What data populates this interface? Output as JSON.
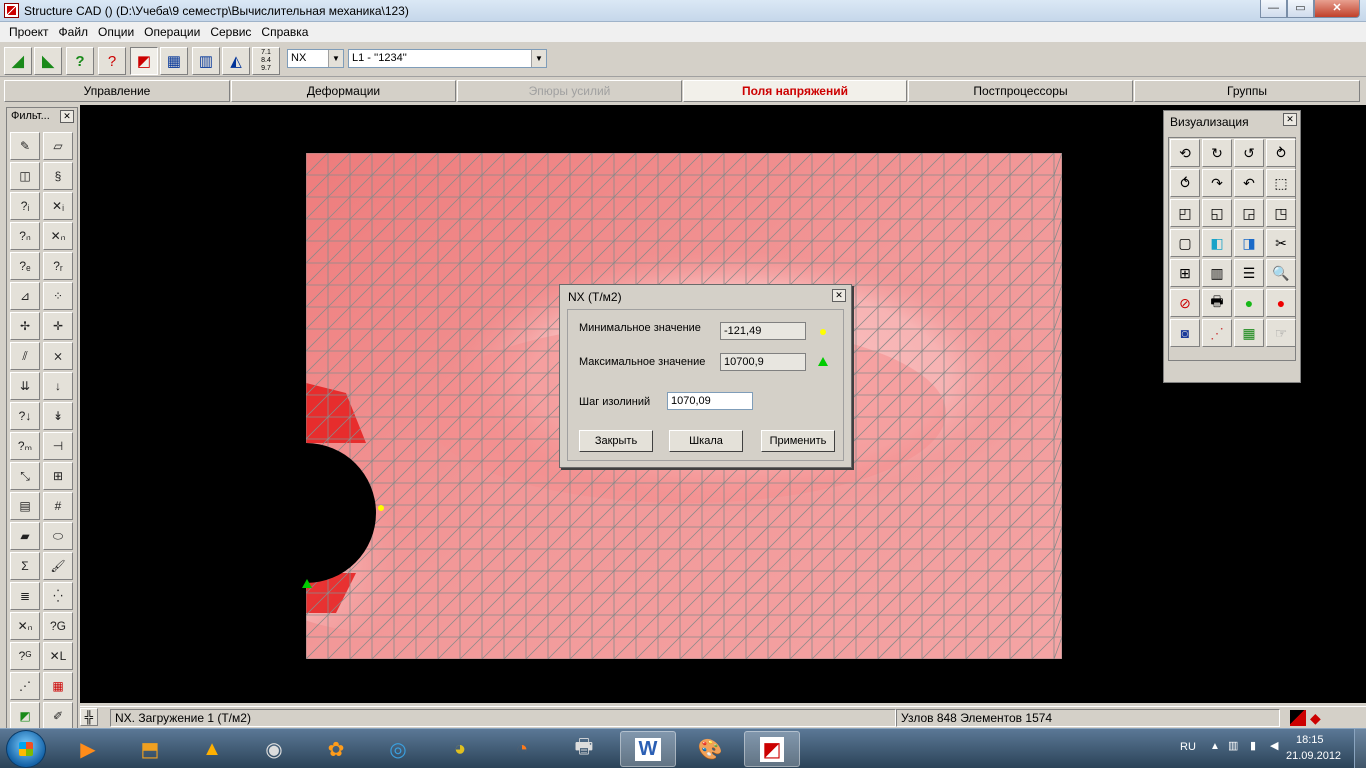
{
  "window": {
    "title": "Structure CAD () (D:\\Учеба\\9 семестр\\Вычислительная механика\\123)",
    "min": "—",
    "max": "▭",
    "close": "✕"
  },
  "menu": [
    "Проект",
    "Файл",
    "Опции",
    "Операции",
    "Сервис",
    "Справка"
  ],
  "toolbar": {
    "field_selector": "NX",
    "load_selector": "L1 - ''1234''",
    "scale_icon_text": "7.1\n8.4\n9.7"
  },
  "tabs": [
    "Управление",
    "Деформации",
    "Эпюры усилий",
    "Поля напряжений",
    "Постпроцессоры",
    "Группы"
  ],
  "filters_panel": {
    "title": "Фильт...",
    "close": "✕"
  },
  "visual_panel": {
    "title": "Визуализация",
    "close": "✕"
  },
  "dialog": {
    "title": "NX (Т/м2)",
    "close": "✕",
    "min_label": "Минимальное значение",
    "min_value": "-121,49",
    "max_label": "Максимальное значение",
    "max_value": "10700,9",
    "step_label": "Шаг изолиний",
    "step_value": "1070,09",
    "btn_close": "Закрыть",
    "btn_scale": "Шкала",
    "btn_apply": "Применить"
  },
  "status": {
    "message": "NX. Загружение 1 (Т/м2)",
    "counts": "Узлов 848 Элементов 1574"
  },
  "taskbar": {
    "lang": "RU",
    "time": "18:15",
    "date": "21.09.2012"
  },
  "colors": {
    "mesh_high": "#e51c1c",
    "mesh_mid": "#f08080",
    "mesh_low": "#fde4e4",
    "grid_line": "#8a8a8a",
    "active_tab": "#cc0000"
  }
}
